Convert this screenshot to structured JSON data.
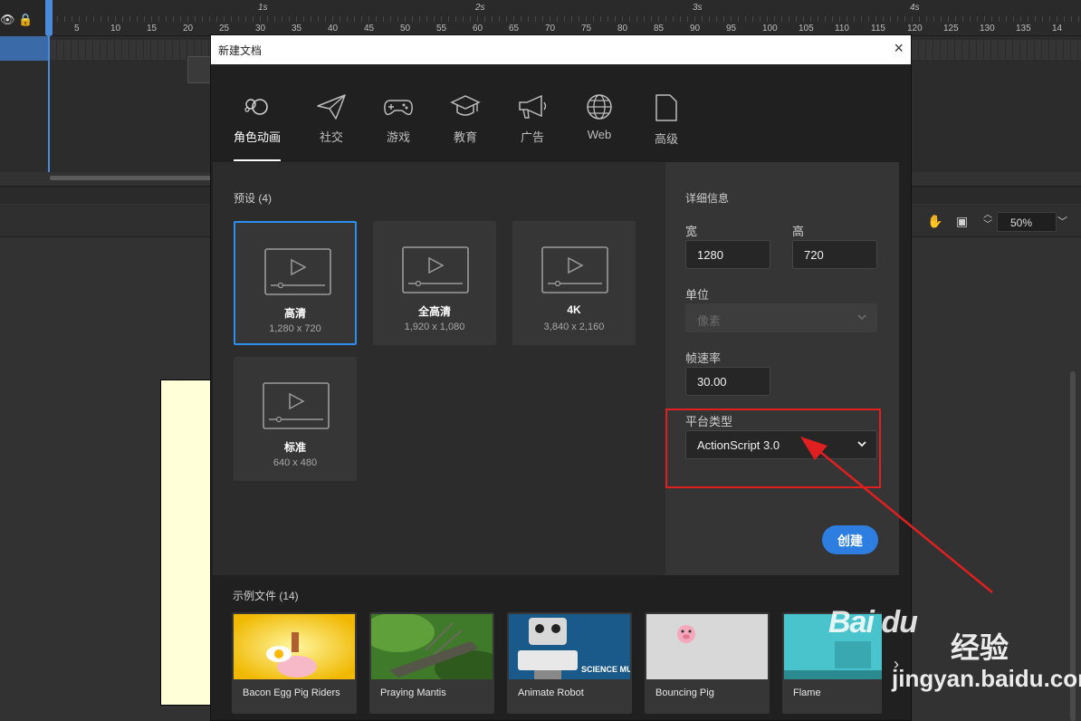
{
  "timeline": {
    "frame_ticks": [
      "5",
      "10",
      "15",
      "20",
      "25",
      "30",
      "35",
      "40",
      "45",
      "50",
      "55",
      "60",
      "65",
      "70",
      "75",
      "80",
      "85",
      "90",
      "95",
      "100",
      "105",
      "110",
      "115",
      "120",
      "125",
      "130",
      "135",
      "14"
    ],
    "second_marks": [
      "1s",
      "2s",
      "3s",
      "4s"
    ]
  },
  "stage_toolbar": {
    "zoom": "50%"
  },
  "dialog": {
    "title": "新建文档",
    "close_glyph": "×",
    "categories": [
      {
        "label": "角色动画",
        "icon": "character-animation-icon"
      },
      {
        "label": "社交",
        "icon": "paper-plane-icon"
      },
      {
        "label": "游戏",
        "icon": "gamepad-icon"
      },
      {
        "label": "教育",
        "icon": "graduation-cap-icon"
      },
      {
        "label": "广告",
        "icon": "megaphone-icon"
      },
      {
        "label": "Web",
        "icon": "globe-icon"
      },
      {
        "label": "高级",
        "icon": "document-icon"
      }
    ],
    "presets_label": "预设 (4)",
    "presets": [
      {
        "name": "高清",
        "size": "1,280 x 720"
      },
      {
        "name": "全高清",
        "size": "1,920 x 1,080"
      },
      {
        "name": "4K",
        "size": "3,840 x 2,160"
      },
      {
        "name": "标准",
        "size": "640 x 480"
      }
    ],
    "details": {
      "heading": "详细信息",
      "width_label": "宽",
      "width_value": "1280",
      "height_label": "高",
      "height_value": "720",
      "unit_label": "单位",
      "unit_value": "像素",
      "fps_label": "帧速率",
      "fps_value": "30.00",
      "platform_label": "平台类型",
      "platform_value": "ActionScript 3.0",
      "create_button": "创建"
    },
    "samples_label": "示例文件 (14)",
    "samples": [
      {
        "name": "Bacon Egg Pig Riders"
      },
      {
        "name": "Praying Mantis"
      },
      {
        "name": "Animate Robot",
        "thumb_text": "SCIENCE MUSEUM"
      },
      {
        "name": "Bouncing Pig"
      },
      {
        "name": "Flame"
      }
    ],
    "samples_next": "›"
  },
  "watermark": {
    "logo": "Bai du",
    "brand": "经验",
    "url": "jingyan.baidu.com"
  },
  "colors": {
    "accent": "#2d7ee0",
    "highlight": "#e02020",
    "dialog_bg": "#202020"
  }
}
